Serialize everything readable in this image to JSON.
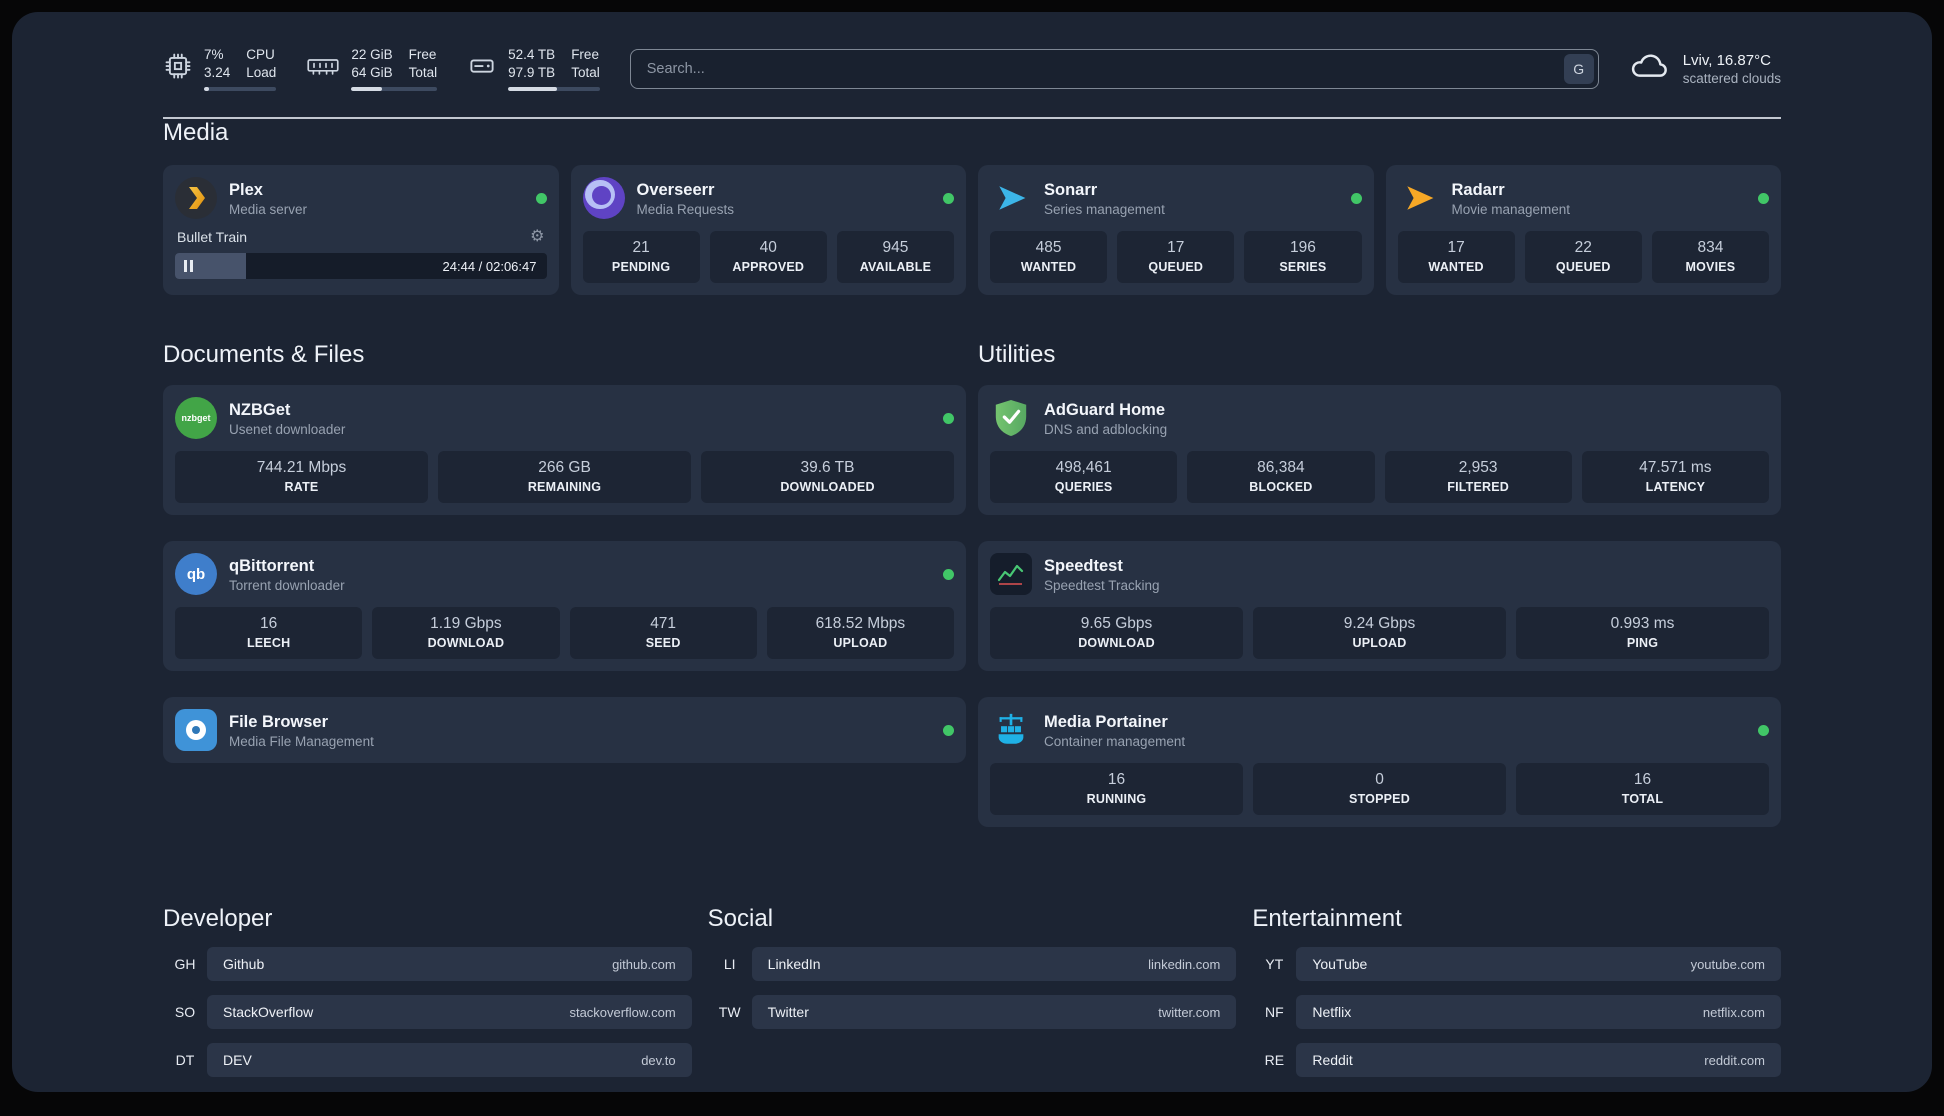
{
  "topbar": {
    "cpu": {
      "percent": "7%",
      "load": "3.24",
      "label_top": "CPU",
      "label_bottom": "Load",
      "bar_pct": 7
    },
    "memory": {
      "free": "22 GiB",
      "total": "64 GiB",
      "label_top": "Free",
      "label_bottom": "Total",
      "bar_pct": 36
    },
    "disk": {
      "free": "52.4 TB",
      "total": "97.9 TB",
      "label_top": "Free",
      "label_bottom": "Total",
      "bar_pct": 53
    },
    "search": {
      "placeholder": "Search...",
      "provider_label": "G"
    },
    "weather": {
      "location": "Lviv, 16.87°C",
      "condition": "scattered clouds"
    }
  },
  "icons": {
    "gear": "⚙"
  },
  "sections": {
    "media": "Media",
    "documents": "Documents & Files",
    "utilities": "Utilities",
    "developer": "Developer",
    "social": "Social",
    "entertainment": "Entertainment"
  },
  "services": {
    "plex": {
      "name": "Plex",
      "desc": "Media server",
      "now_playing": "Bullet Train",
      "time": "24:44 / 02:06:47",
      "progress_pct": 19
    },
    "overseerr": {
      "name": "Overseerr",
      "desc": "Media Requests",
      "stats": [
        {
          "value": "21",
          "label": "PENDING"
        },
        {
          "value": "40",
          "label": "APPROVED"
        },
        {
          "value": "945",
          "label": "AVAILABLE"
        }
      ]
    },
    "sonarr": {
      "name": "Sonarr",
      "desc": "Series management",
      "stats": [
        {
          "value": "485",
          "label": "WANTED"
        },
        {
          "value": "17",
          "label": "QUEUED"
        },
        {
          "value": "196",
          "label": "SERIES"
        }
      ]
    },
    "radarr": {
      "name": "Radarr",
      "desc": "Movie management",
      "stats": [
        {
          "value": "17",
          "label": "WANTED"
        },
        {
          "value": "22",
          "label": "QUEUED"
        },
        {
          "value": "834",
          "label": "MOVIES"
        }
      ]
    },
    "nzbget": {
      "name": "NZBGet",
      "desc": "Usenet downloader",
      "icon_text": "nzbget",
      "stats": [
        {
          "value": "744.21 Mbps",
          "label": "RATE"
        },
        {
          "value": "266 GB",
          "label": "REMAINING"
        },
        {
          "value": "39.6 TB",
          "label": "DOWNLOADED"
        }
      ]
    },
    "qbittorrent": {
      "name": "qBittorrent",
      "desc": "Torrent downloader",
      "icon_text": "qb",
      "stats": [
        {
          "value": "16",
          "label": "LEECH"
        },
        {
          "value": "1.19 Gbps",
          "label": "DOWNLOAD"
        },
        {
          "value": "471",
          "label": "SEED"
        },
        {
          "value": "618.52 Mbps",
          "label": "UPLOAD"
        }
      ]
    },
    "filebrowser": {
      "name": "File Browser",
      "desc": "Media File Management"
    },
    "adguard": {
      "name": "AdGuard Home",
      "desc": "DNS and adblocking",
      "stats": [
        {
          "value": "498,461",
          "label": "QUERIES"
        },
        {
          "value": "86,384",
          "label": "BLOCKED"
        },
        {
          "value": "2,953",
          "label": "FILTERED"
        },
        {
          "value": "47.571 ms",
          "label": "LATENCY"
        }
      ]
    },
    "speedtest": {
      "name": "Speedtest",
      "desc": "Speedtest Tracking",
      "stats": [
        {
          "value": "9.65 Gbps",
          "label": "DOWNLOAD"
        },
        {
          "value": "9.24 Gbps",
          "label": "UPLOAD"
        },
        {
          "value": "0.993 ms",
          "label": "PING"
        }
      ]
    },
    "portainer": {
      "name": "Media Portainer",
      "desc": "Container management",
      "stats": [
        {
          "value": "16",
          "label": "RUNNING"
        },
        {
          "value": "0",
          "label": "STOPPED"
        },
        {
          "value": "16",
          "label": "TOTAL"
        }
      ]
    }
  },
  "bookmarks": {
    "developer": [
      {
        "abbr": "GH",
        "name": "Github",
        "domain": "github.com"
      },
      {
        "abbr": "SO",
        "name": "StackOverflow",
        "domain": "stackoverflow.com"
      },
      {
        "abbr": "DT",
        "name": "DEV",
        "domain": "dev.to"
      }
    ],
    "social": [
      {
        "abbr": "LI",
        "name": "LinkedIn",
        "domain": "linkedin.com"
      },
      {
        "abbr": "TW",
        "name": "Twitter",
        "domain": "twitter.com"
      }
    ],
    "entertainment": [
      {
        "abbr": "YT",
        "name": "YouTube",
        "domain": "youtube.com"
      },
      {
        "abbr": "NF",
        "name": "Netflix",
        "domain": "netflix.com"
      },
      {
        "abbr": "RE",
        "name": "Reddit",
        "domain": "reddit.com"
      }
    ]
  }
}
